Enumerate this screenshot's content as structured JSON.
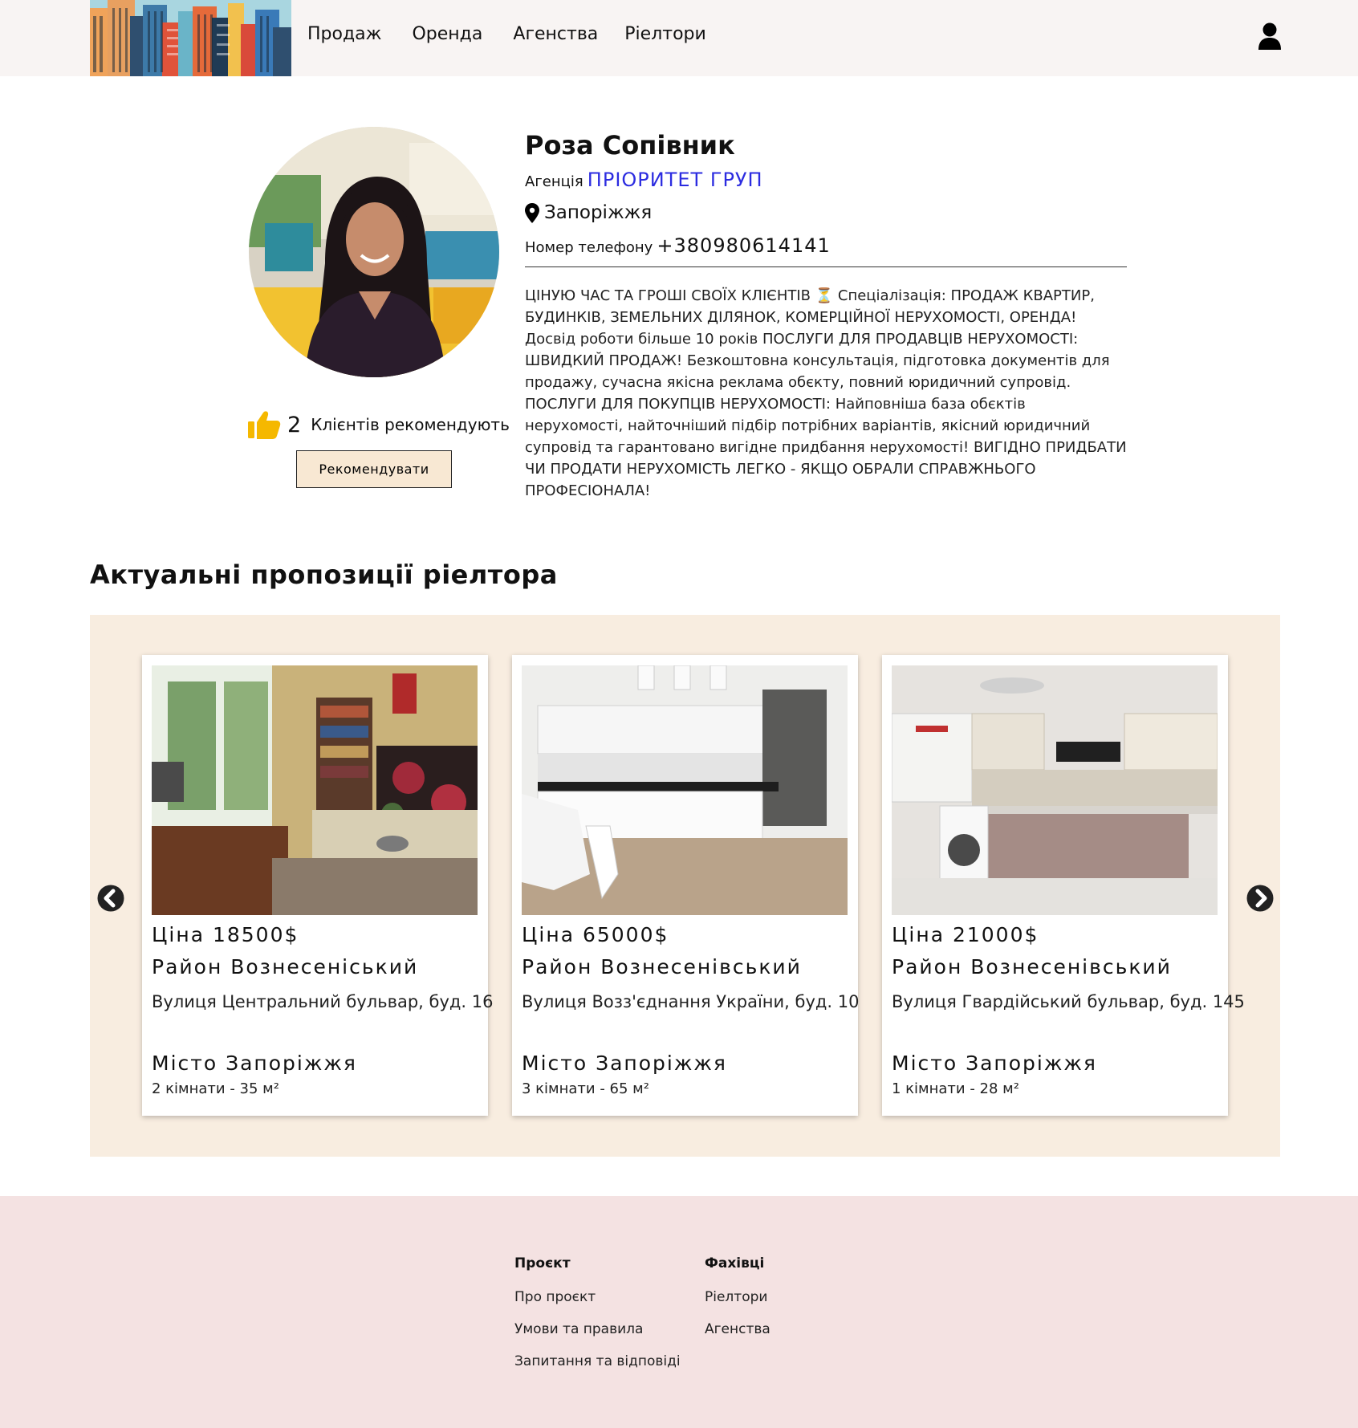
{
  "header": {
    "nav": [
      "Продаж",
      "Оренда",
      "Агенства",
      "Ріелтори"
    ]
  },
  "profile": {
    "name": "Роза Сопівник",
    "agency_label": "Агенція",
    "agency_name": "ПРІОРИТЕТ ГРУП",
    "city": "Запоріжжя",
    "phone_label": "Номер телефону",
    "phone": "+380980614141",
    "bio": "ЦІНУЮ ЧАС ТА ГРОШІ СВОЇХ КЛІЄНТІВ ⏳ Спеціалізація: ПРОДАЖ КВАРТИР, БУДИНКІВ, ЗЕМЕЛЬНИХ ДІЛЯНОК, КОМЕРЦІЙНОЇ НЕРУХОМОСТІ, ОРЕНДА! Досвід роботи більше 10 років ПОСЛУГИ ДЛЯ ПРОДАВЦІВ НЕРУХОМОСТІ: ШВИДКИЙ ПРОДАЖ! Безкоштовна консультація, підготовка документів для продажу, сучасна якісна реклама обєкту, повний юридичний супровід. ПОСЛУГИ ДЛЯ ПОКУПЦІВ НЕРУХОМОСТІ: Найповніша база обєктів нерухомості, найточніший підбір потрібних варіантів, якісний юридичний супровід та гарантовано вигідне придбання нерухомості! ВИГІДНО ПРИДБАТИ ЧИ ПРОДАТИ НЕРУХОМІСТЬ ЛЕГКО - ЯКЩО ОБРАЛИ СПРАВЖНЬОГО ПРОФЕСІОНАЛА!",
    "recommend_count": "2",
    "recommend_text": "Клієнтів рекомендують",
    "recommend_button": "Рекомендувати"
  },
  "listings": {
    "title": "Актуальні пропозиції ріелтора",
    "cards": [
      {
        "price": "Ціна 18500$",
        "district": "Район Вознесеніський",
        "street": "Вулиця Центральний бульвар, буд. 16",
        "city": "Місто Запоріжжя",
        "rooms": "2 кімнати - 35 м²"
      },
      {
        "price": "Ціна 65000$",
        "district": "Район Вознесенівський",
        "street": "Вулиця Возз'єднання України, буд. 10",
        "city": "Місто Запоріжжя",
        "rooms": "3 кімнати - 65 м²"
      },
      {
        "price": "Ціна 21000$",
        "district": "Район Вознесенівський",
        "street": "Вулиця Гвардійський бульвар, буд. 145",
        "city": "Місто Запоріжжя",
        "rooms": "1 кімнати - 28 м²"
      }
    ]
  },
  "footer": {
    "col1": {
      "heading": "Проєкт",
      "links": [
        "Про проєкт",
        "Умови та правила",
        "Запитання та відповіді"
      ]
    },
    "col2": {
      "heading": "Фахівці",
      "links": [
        "Ріелтори",
        "Агенства"
      ]
    }
  },
  "colors": {
    "header_bg": "#f8f4f3",
    "agency_link": "#2c2ce0",
    "carousel_bg": "#f8ede0",
    "button_bg": "#f8e8d3",
    "footer_bg": "#f4e2e2",
    "thumb": "#f5b800"
  },
  "icons": [
    "city-logo",
    "user-icon",
    "thumbs-up-icon",
    "map-pin-icon",
    "arrow-left-icon",
    "arrow-right-icon"
  ]
}
